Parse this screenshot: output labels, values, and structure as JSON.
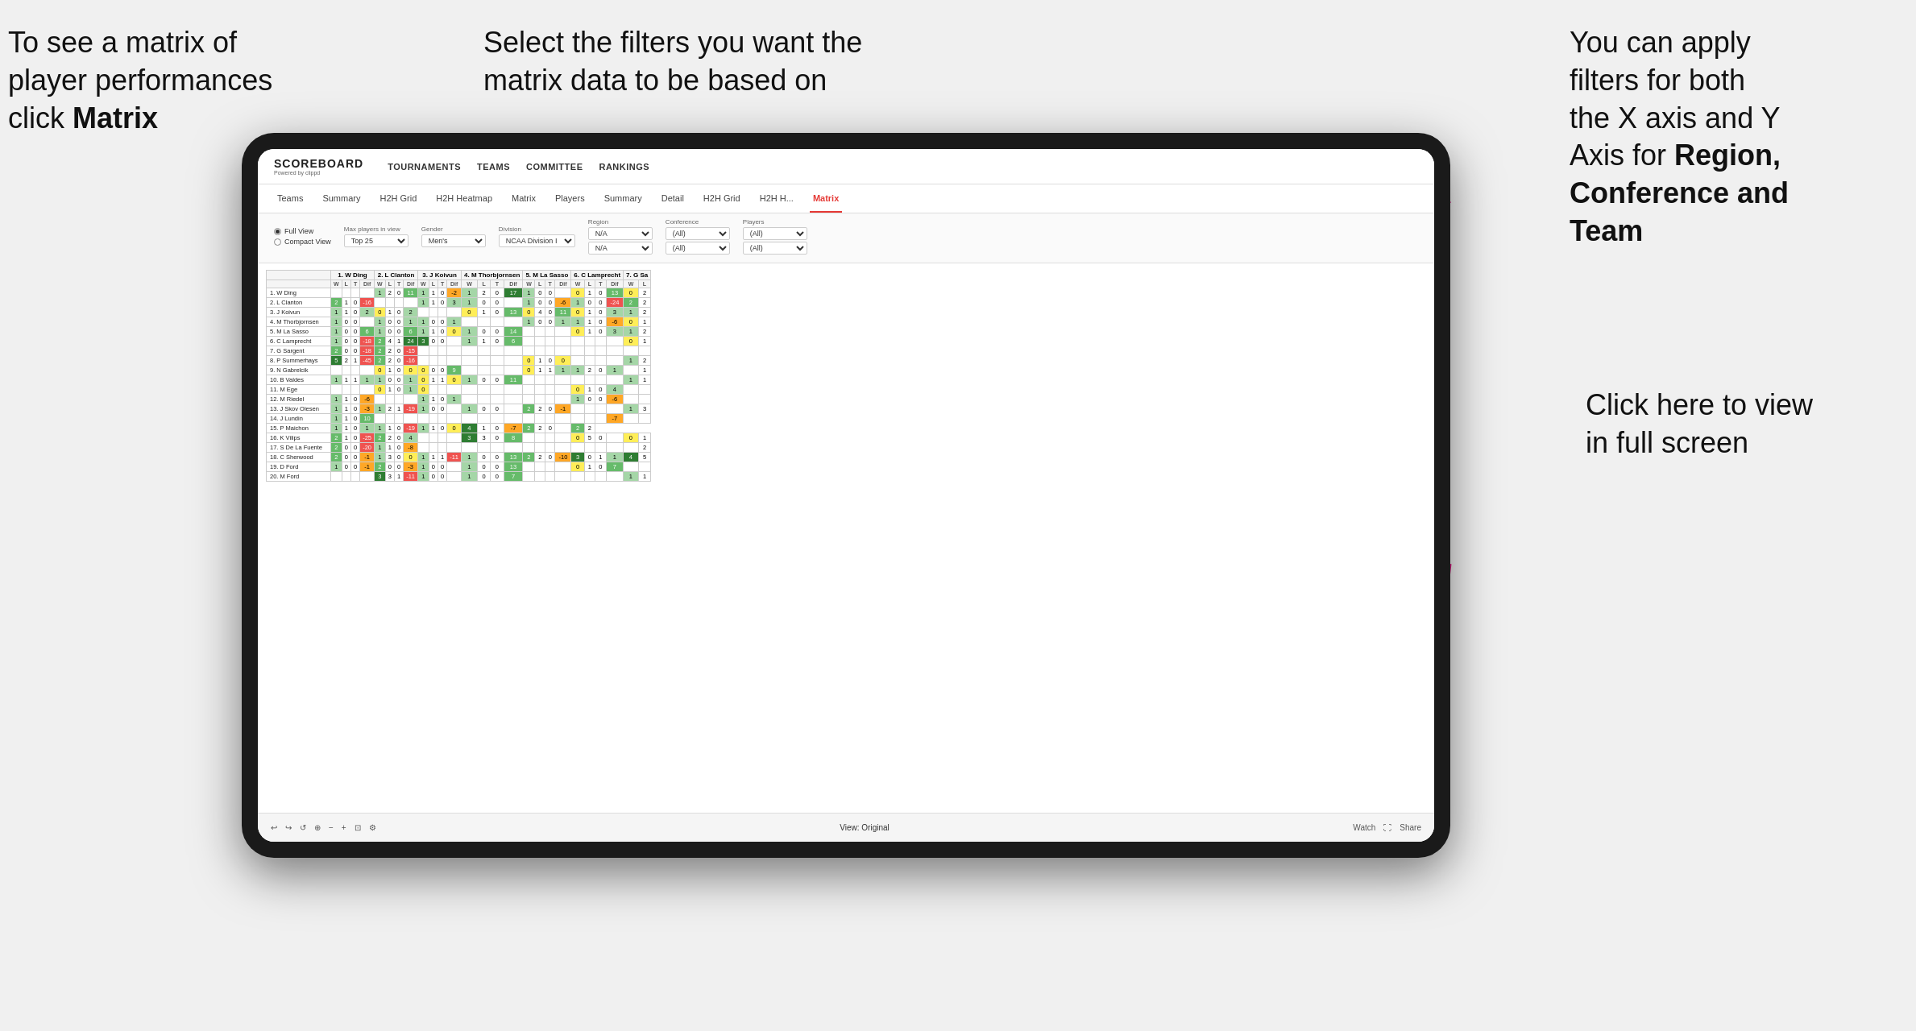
{
  "annotations": {
    "top_left": {
      "line1": "To see a matrix of",
      "line2": "player performances",
      "line3_prefix": "click ",
      "line3_bold": "Matrix"
    },
    "top_center": {
      "line1": "Select the filters you want the",
      "line2": "matrix data to be based on"
    },
    "top_right": {
      "line1": "You  can apply",
      "line2": "filters for both",
      "line3": "the X axis and Y",
      "line4_prefix": "Axis for ",
      "line4_bold": "Region,",
      "line5_bold": "Conference and",
      "line6_bold": "Team"
    },
    "bottom_right": {
      "line1": "Click here to view",
      "line2": "in full screen"
    }
  },
  "nav": {
    "logo_main": "SCOREBOARD",
    "logo_sub": "Powered by clippd",
    "items": [
      "TOURNAMENTS",
      "TEAMS",
      "COMMITTEE",
      "RANKINGS"
    ]
  },
  "sub_nav": {
    "items": [
      "Teams",
      "Summary",
      "H2H Grid",
      "H2H Heatmap",
      "Matrix",
      "Players",
      "Summary",
      "Detail",
      "H2H Grid",
      "H2H H...",
      "Matrix"
    ]
  },
  "filters": {
    "view_options": [
      "Full View",
      "Compact View"
    ],
    "selected_view": "Full View",
    "max_players": {
      "label": "Max players in view",
      "value": "Top 25"
    },
    "gender": {
      "label": "Gender",
      "value": "Men's"
    },
    "division": {
      "label": "Division",
      "value": "NCAA Division I"
    },
    "region": {
      "label": "Region",
      "value1": "N/A",
      "value2": "N/A"
    },
    "conference": {
      "label": "Conference",
      "value1": "(All)",
      "value2": "(All)"
    },
    "players": {
      "label": "Players",
      "value1": "(All)",
      "value2": "(All)"
    }
  },
  "matrix": {
    "col_headers": [
      "1. W Ding",
      "2. L Clanton",
      "3. J Koivun",
      "4. M Thorbjornsen",
      "5. M La Sasso",
      "6. C Lamprecht",
      "7. G Sa"
    ],
    "sub_cols": [
      "W",
      "L",
      "T",
      "Dif"
    ],
    "rows": [
      {
        "label": "1. W Ding",
        "cells": [
          "",
          "",
          "",
          "",
          "1",
          "2",
          "0",
          "11",
          "1",
          "1",
          "0",
          "-2",
          "1",
          "2",
          "0",
          "17",
          "1",
          "0",
          "0",
          "",
          "0",
          "1",
          "0",
          "13",
          "0",
          "2"
        ]
      },
      {
        "label": "2. L Clanton",
        "cells": [
          "2",
          "1",
          "0",
          "-16",
          "",
          "",
          "",
          "",
          "1",
          "1",
          "0",
          "3",
          "1",
          "0",
          "0",
          "",
          "1",
          "0",
          "0",
          "-6",
          "1",
          "0",
          "0",
          "-24",
          "2",
          "2"
        ]
      },
      {
        "label": "3. J Koivun",
        "cells": [
          "1",
          "1",
          "0",
          "2",
          "0",
          "1",
          "0",
          "2",
          "",
          "",
          "",
          "",
          "0",
          "1",
          "0",
          "13",
          "0",
          "4",
          "0",
          "11",
          "0",
          "1",
          "0",
          "3",
          "1",
          "2"
        ]
      },
      {
        "label": "4. M Thorbjornsen",
        "cells": [
          "1",
          "0",
          "0",
          "",
          "1",
          "0",
          "0",
          "1",
          "1",
          "0",
          "0",
          "1",
          "",
          "",
          "",
          "",
          "1",
          "0",
          "0",
          "1",
          "1",
          "1",
          "0",
          "-6",
          "0",
          "1"
        ]
      },
      {
        "label": "5. M La Sasso",
        "cells": [
          "1",
          "0",
          "0",
          "6",
          "1",
          "0",
          "0",
          "6",
          "1",
          "1",
          "0",
          "0",
          "1",
          "0",
          "0",
          "14",
          "",
          "",
          "",
          "",
          "0",
          "1",
          "0",
          "3",
          "1",
          "2"
        ]
      },
      {
        "label": "6. C Lamprecht",
        "cells": [
          "1",
          "0",
          "0",
          "-18",
          "2",
          "4",
          "1",
          "24",
          "3",
          "0",
          "0",
          "",
          "1",
          "1",
          "0",
          "6",
          "",
          "",
          "",
          "",
          "",
          "",
          "",
          "",
          "0",
          "1"
        ]
      },
      {
        "label": "7. G Sargent",
        "cells": [
          "2",
          "0",
          "0",
          "-18",
          "2",
          "2",
          "0",
          "-15",
          "",
          "",
          "",
          "",
          "",
          "",
          "",
          "",
          "",
          "",
          "",
          "",
          "",
          "",
          "",
          "",
          "",
          ""
        ]
      },
      {
        "label": "8. P Summerhays",
        "cells": [
          "5",
          "2",
          "1",
          "-45",
          "2",
          "2",
          "0",
          "-16",
          "",
          "",
          "",
          "",
          "",
          "",
          "",
          "",
          "0",
          "1",
          "0",
          "0",
          "",
          "",
          "",
          "",
          "1",
          "2"
        ]
      },
      {
        "label": "9. N Gabrelcik",
        "cells": [
          "",
          "",
          "",
          "",
          "0",
          "1",
          "0",
          "0",
          "0",
          "0",
          "0",
          "9",
          "",
          "",
          "",
          "",
          "0",
          "1",
          "1",
          "1",
          "1",
          "2",
          "0",
          "1",
          "",
          "1"
        ]
      },
      {
        "label": "10. B Valdes",
        "cells": [
          "1",
          "1",
          "1",
          "1",
          "1",
          "0",
          "0",
          "1",
          "0",
          "1",
          "1",
          "0",
          "1",
          "0",
          "0",
          "11",
          "",
          "",
          "",
          "",
          "",
          "",
          "",
          "",
          "1",
          "1"
        ]
      },
      {
        "label": "11. M Ege",
        "cells": [
          "",
          "",
          "",
          "",
          "0",
          "1",
          "0",
          "1",
          "0",
          "",
          "",
          "",
          "",
          "",
          "",
          "",
          "",
          "",
          "",
          "",
          "0",
          "1",
          "0",
          "4",
          "",
          ""
        ]
      },
      {
        "label": "12. M Riedel",
        "cells": [
          "1",
          "1",
          "0",
          "-6",
          "",
          "",
          "",
          "",
          "1",
          "1",
          "0",
          "1",
          "",
          "",
          "",
          "",
          "",
          "",
          "",
          "",
          "1",
          "0",
          "0",
          "-6",
          "",
          ""
        ]
      },
      {
        "label": "13. J Skov Olesen",
        "cells": [
          "1",
          "1",
          "0",
          "-3",
          "1",
          "2",
          "1",
          "-19",
          "1",
          "0",
          "0",
          "",
          "1",
          "0",
          "0",
          "",
          "2",
          "2",
          "0",
          "-1",
          "",
          "",
          "",
          "",
          "1",
          "3"
        ]
      },
      {
        "label": "14. J Lundin",
        "cells": [
          "1",
          "1",
          "0",
          "10",
          "",
          "",
          "",
          "",
          "",
          "",
          "",
          "",
          "",
          "",
          "",
          "",
          "",
          "",
          "",
          "",
          "",
          "",
          "",
          "-7",
          "",
          ""
        ]
      },
      {
        "label": "15. P Maichon",
        "cells": [
          "1",
          "1",
          "0",
          "1",
          "1",
          "1",
          "0",
          "-19",
          "1",
          "1",
          "0",
          "0",
          "4",
          "1",
          "0",
          "-7",
          "2",
          "2",
          "0",
          "",
          "2",
          "2"
        ]
      },
      {
        "label": "16. K Vilips",
        "cells": [
          "2",
          "1",
          "0",
          "-25",
          "2",
          "2",
          "0",
          "4",
          "",
          "",
          "",
          "",
          "3",
          "3",
          "0",
          "8",
          "",
          "",
          "",
          "",
          "0",
          "5",
          "0",
          "",
          "0",
          "1"
        ]
      },
      {
        "label": "17. S De La Fuente",
        "cells": [
          "2",
          "0",
          "0",
          "-20",
          "1",
          "1",
          "0",
          "-8",
          "",
          "",
          "",
          "",
          "",
          "",
          "",
          "",
          "",
          "",
          "",
          "",
          "",
          "",
          "",
          "",
          "",
          "2"
        ]
      },
      {
        "label": "18. C Sherwood",
        "cells": [
          "2",
          "0",
          "0",
          "-1",
          "1",
          "3",
          "0",
          "0",
          "1",
          "1",
          "1",
          "-11",
          "1",
          "0",
          "0",
          "13",
          "2",
          "2",
          "0",
          "-10",
          "3",
          "0",
          "1",
          "1",
          "4",
          "5"
        ]
      },
      {
        "label": "19. D Ford",
        "cells": [
          "1",
          "0",
          "0",
          "-1",
          "2",
          "0",
          "0",
          "-3",
          "1",
          "0",
          "0",
          "",
          "1",
          "0",
          "0",
          "13",
          "",
          "",
          "",
          "",
          "0",
          "1",
          "0",
          "7",
          "",
          ""
        ]
      },
      {
        "label": "20. M Ford",
        "cells": [
          "",
          "",
          "",
          "",
          "3",
          "3",
          "1",
          "-11",
          "1",
          "0",
          "0",
          "",
          "1",
          "0",
          "0",
          "7",
          "",
          "",
          "",
          "",
          "",
          "",
          "",
          "",
          "1",
          "1"
        ]
      }
    ]
  },
  "toolbar": {
    "view_label": "View: Original",
    "watch_label": "Watch",
    "share_label": "Share"
  }
}
